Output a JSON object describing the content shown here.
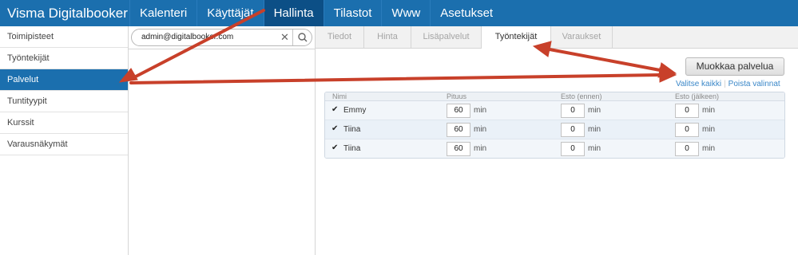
{
  "app": {
    "title": "Visma Digitalbooker"
  },
  "nav": [
    "Kalenteri",
    "Käyttäjät",
    "Hallinta",
    "Tilastot",
    "Www",
    "Asetukset"
  ],
  "sidebar": [
    "Toimipisteet",
    "Työntekijät",
    "Palvelut",
    "Tuntityypit",
    "Kurssit",
    "Varausnäkymät"
  ],
  "search": {
    "value": "admin@digitalbooker.com"
  },
  "tabs": [
    "Tiedot",
    "Hinta",
    "Lisäpalvelut",
    "Työntekijät",
    "Varaukset"
  ],
  "actions": {
    "edit": "Muokkaa palvelua",
    "select_all": "Valitse kaikki",
    "deselect": "Poista valinnat"
  },
  "table": {
    "headers": [
      "Nimi",
      "Pituus",
      "Esto (ennen)",
      "Esto (jälkeen)"
    ],
    "unit": "min",
    "rows": [
      {
        "name": "Emmy",
        "length": "60",
        "before": "0",
        "after": "0"
      },
      {
        "name": "Tiina",
        "length": "60",
        "before": "0",
        "after": "0"
      },
      {
        "name": "Tiina",
        "length": "60",
        "before": "0",
        "after": "0"
      }
    ]
  },
  "colors": {
    "brand_blue": "#1b6fae",
    "active_nav": "#0c4f86",
    "annotation_arrow": "#c8402a"
  }
}
